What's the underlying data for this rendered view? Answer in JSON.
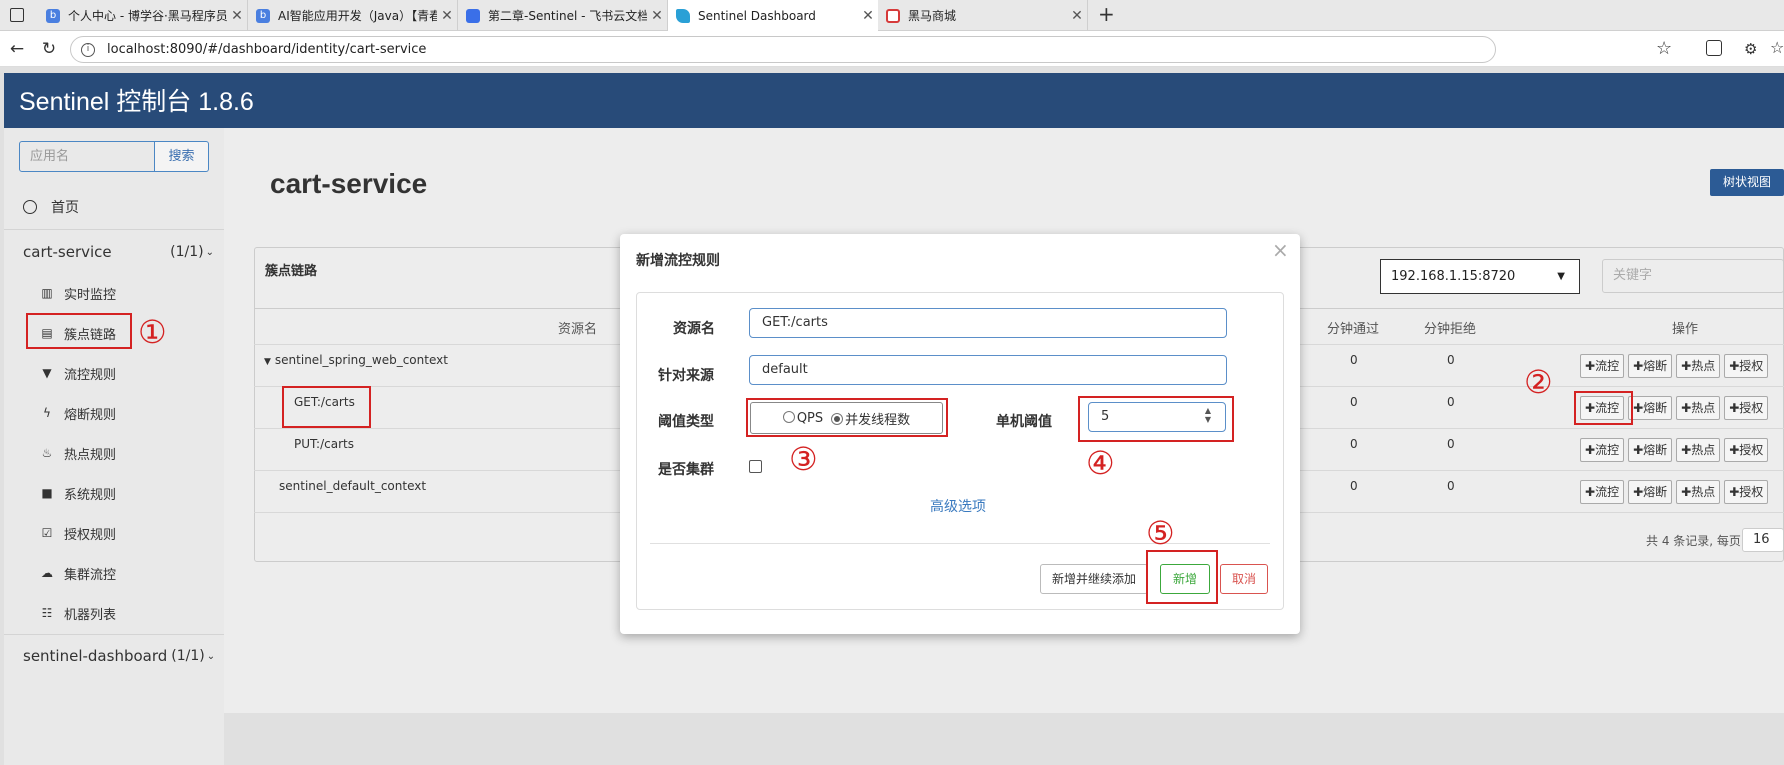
{
  "browser": {
    "tabs": [
      {
        "title": "个人中心 - 博学谷·黑马程序员线上",
        "icon": "b-icon",
        "color": "#4a7fe0"
      },
      {
        "title": "AI智能应用开发（Java）【青春版",
        "icon": "b-icon",
        "color": "#4a7fe0"
      },
      {
        "title": "第二章-Sentinel - 飞书云文档",
        "icon": "doc-icon",
        "color": "#3a6fe8"
      },
      {
        "title": "Sentinel Dashboard",
        "icon": "sentinel-icon",
        "color": "#2aa0d6"
      },
      {
        "title": "黑马商城",
        "icon": "shop-icon",
        "color": "#d63a3a"
      }
    ],
    "new_tab": "+",
    "url": "localhost:8090/#/dashboard/identity/cart-service"
  },
  "app": {
    "brand": "Sentinel 控制台 1.8.6",
    "search": {
      "placeholder": "应用名",
      "button": "搜索"
    },
    "home": "首页",
    "apps": [
      {
        "name": "cart-service",
        "count": "(1/1)"
      },
      {
        "name": "sentinel-dashboard",
        "count": "(1/1)"
      }
    ],
    "menu": [
      {
        "label": "实时监控",
        "icon": "bar-chart-icon"
      },
      {
        "label": "簇点链路",
        "icon": "list-icon"
      },
      {
        "label": "流控规则",
        "icon": "filter-icon"
      },
      {
        "label": "熔断规则",
        "icon": "flash-icon"
      },
      {
        "label": "热点规则",
        "icon": "fire-icon"
      },
      {
        "label": "系统规则",
        "icon": "lock-icon"
      },
      {
        "label": "授权规则",
        "icon": "check-icon"
      },
      {
        "label": "集群流控",
        "icon": "cloud-icon"
      },
      {
        "label": "机器列表",
        "icon": "th-list-icon"
      }
    ]
  },
  "main": {
    "title": "cart-service",
    "tree_view": "树状视图",
    "panel_title": "簇点链路",
    "machine": "192.168.1.15:8720",
    "keyword_placeholder": "关键字",
    "columns": {
      "resource": "资源名",
      "pass_min": "分钟通过",
      "block_min": "分钟拒绝",
      "ops": "操作"
    },
    "rows": [
      {
        "name": "sentinel_spring_web_context",
        "pass": "0",
        "block": "0"
      },
      {
        "name": "GET:/carts",
        "pass": "0",
        "block": "0"
      },
      {
        "name": "PUT:/carts",
        "pass": "0",
        "block": "0"
      },
      {
        "name": "sentinel_default_context",
        "pass": "0",
        "block": "0"
      }
    ],
    "ops": {
      "flow": "流控",
      "degrade": "熔断",
      "hot": "热点",
      "auth": "授权"
    },
    "footer": "共 4 条记录, 每页",
    "page_size": "16"
  },
  "modal": {
    "title": "新增流控规则",
    "close": "×",
    "resource_label": "资源名",
    "resource_value": "GET:/carts",
    "origin_label": "针对来源",
    "origin_value": "default",
    "grade_label": "阈值类型",
    "grade_options": [
      "QPS",
      "并发线程数"
    ],
    "grade_selected": "并发线程数",
    "count_label": "单机阈值",
    "count_value": "5",
    "cluster_label": "是否集群",
    "cluster_checked": false,
    "advanced": "高级选项",
    "buttons": {
      "save_continue": "新增并继续添加",
      "add": "新增",
      "cancel": "取消"
    }
  },
  "annotations": [
    "①",
    "②",
    "③",
    "④",
    "⑤"
  ],
  "colors": {
    "header": "#284b79",
    "annotation": "#d42222",
    "link": "#3a7abf",
    "success": "#3ca83c",
    "danger": "#d9534f"
  }
}
